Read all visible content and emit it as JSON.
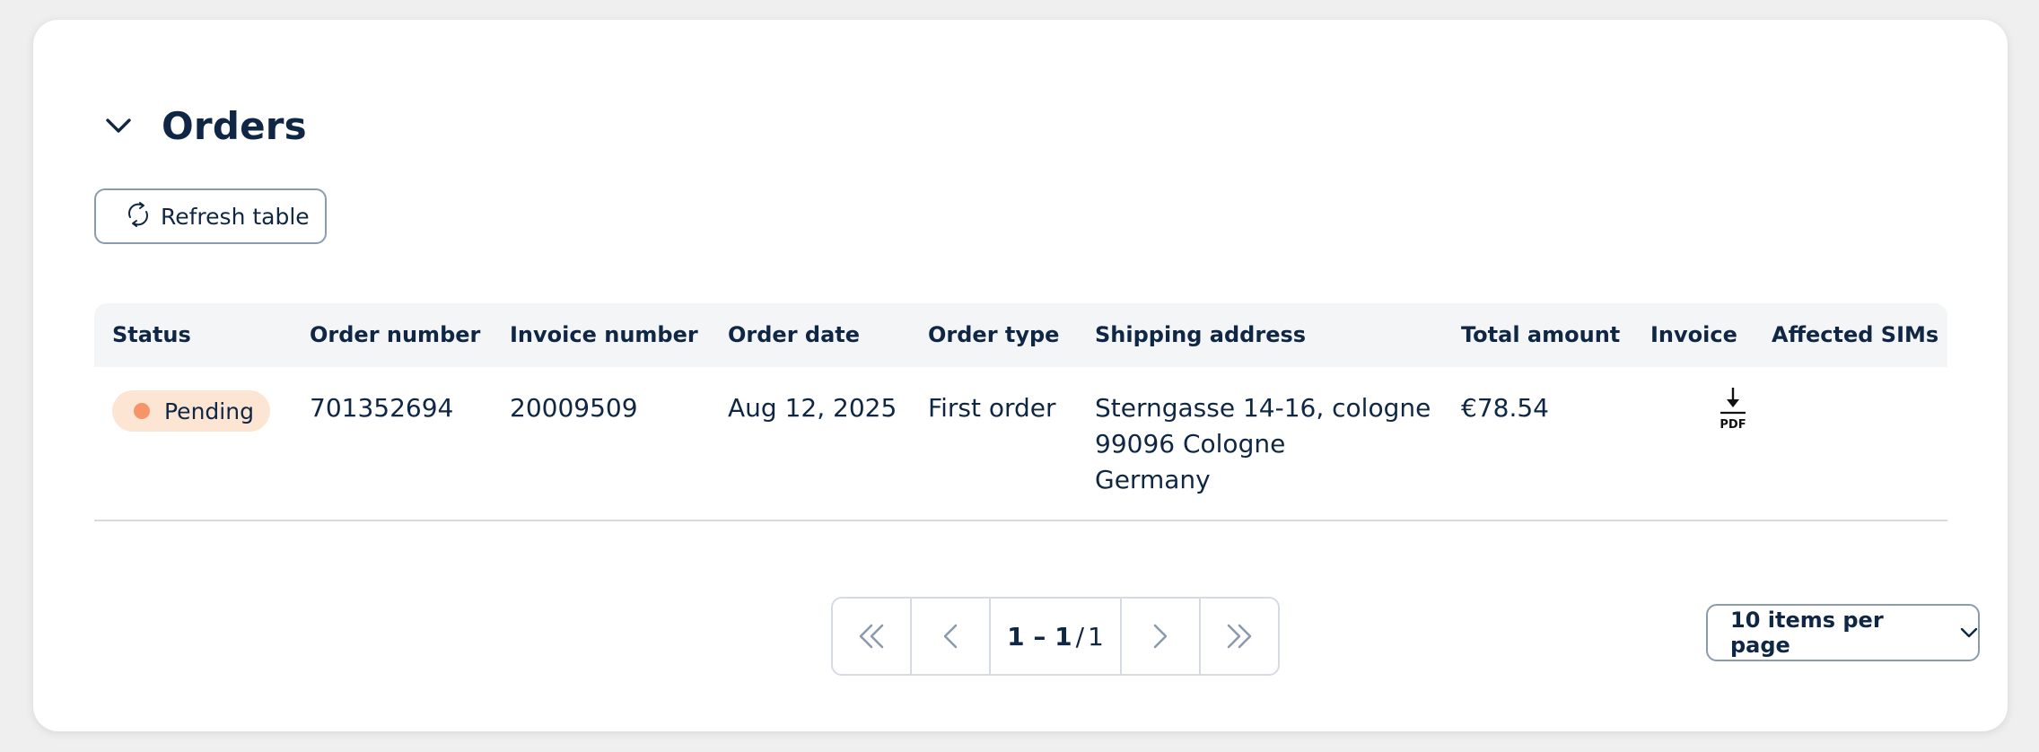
{
  "section": {
    "title": "Orders",
    "collapse_icon": "chevron-down-icon"
  },
  "toolbar": {
    "refresh_label": "Refresh table",
    "refresh_icon": "refresh-icon"
  },
  "table": {
    "columns": [
      "Status",
      "Order number",
      "Invoice number",
      "Order date",
      "Order type",
      "Shipping address",
      "Total amount",
      "Invoice",
      "Affected SIMs"
    ],
    "rows": [
      {
        "status": "Pending",
        "order_number": "701352694",
        "invoice_number": "20009509",
        "order_date": "Aug 12, 2025",
        "order_type": "First order",
        "address_line1": "Sterngasse 14-16, cologne",
        "address_line2": "99096 Cologne",
        "address_line3": "Germany",
        "total_amount": "€78.54",
        "invoice_icon": "pdf-download-icon",
        "invoice_icon_text": "PDF",
        "affected_sims": ""
      }
    ]
  },
  "pagination": {
    "range": "1 – 1",
    "separator": "/",
    "total_pages": "1",
    "items_per_page_label": "10 items per page"
  },
  "colors": {
    "text": "#0f2744",
    "status_pending_bg": "#fde5d3",
    "status_pending_dot": "#f7956a",
    "border": "#8a9bb0",
    "header_bg": "#f4f5f7"
  }
}
